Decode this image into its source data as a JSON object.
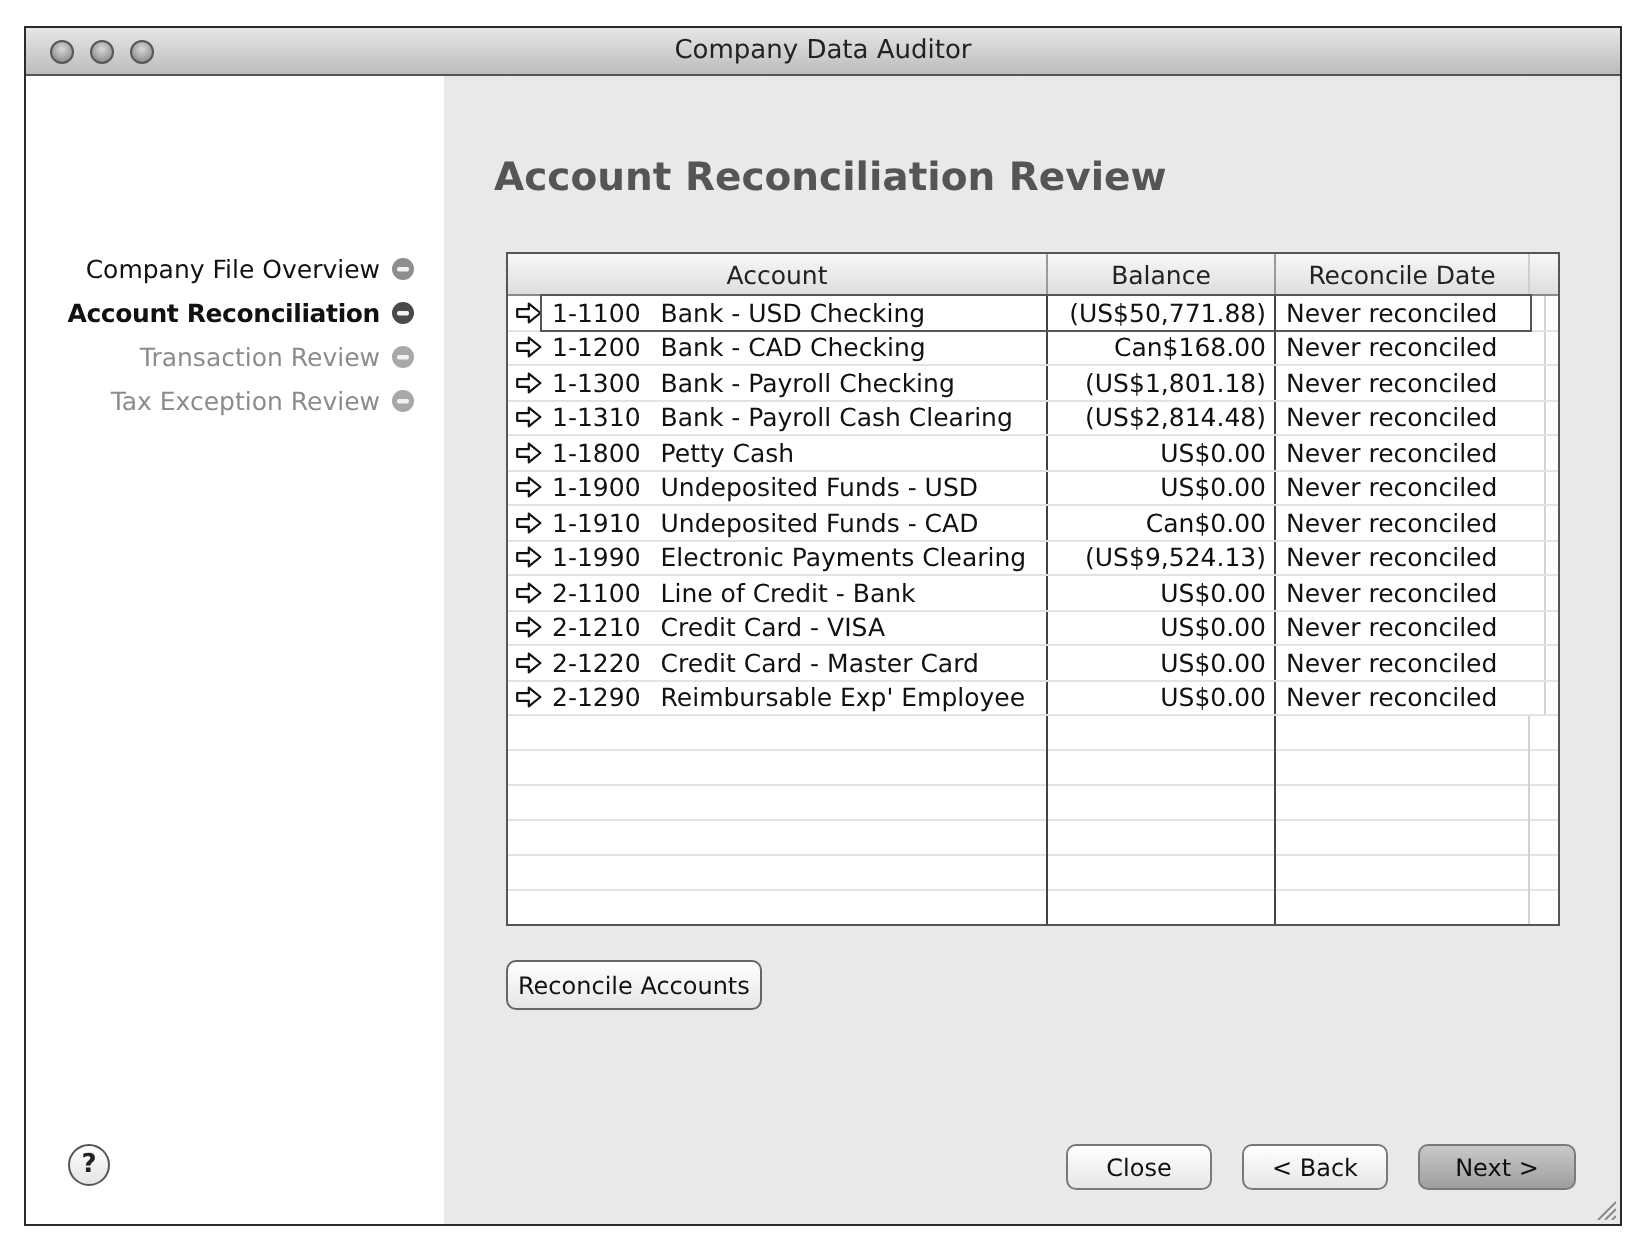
{
  "window": {
    "title": "Company Data Auditor"
  },
  "steps": [
    {
      "label": "Company File Overview",
      "selected": false,
      "disabled": false
    },
    {
      "label": "Account Reconciliation",
      "selected": true,
      "disabled": false
    },
    {
      "label": "Transaction Review",
      "selected": false,
      "disabled": true
    },
    {
      "label": "Tax Exception Review",
      "selected": false,
      "disabled": true
    }
  ],
  "help_button": "?",
  "heading": "Account Reconciliation Review",
  "table": {
    "columns": [
      "Account",
      "Balance",
      "Reconcile Date"
    ],
    "rows": [
      {
        "code": "1-1100",
        "account": "Bank - USD Checking",
        "balance": "(US$50,771.88)",
        "reconcile_date": "Never reconciled",
        "selected": true
      },
      {
        "code": "1-1200",
        "account": "Bank - CAD Checking",
        "balance": "Can$168.00",
        "reconcile_date": "Never reconciled",
        "selected": false
      },
      {
        "code": "1-1300",
        "account": "Bank - Payroll Checking",
        "balance": "(US$1,801.18)",
        "reconcile_date": "Never reconciled",
        "selected": false
      },
      {
        "code": "1-1310",
        "account": "Bank - Payroll Cash Clearing",
        "balance": "(US$2,814.48)",
        "reconcile_date": "Never reconciled",
        "selected": false
      },
      {
        "code": "1-1800",
        "account": "Petty Cash",
        "balance": "US$0.00",
        "reconcile_date": "Never reconciled",
        "selected": false
      },
      {
        "code": "1-1900",
        "account": "Undeposited Funds - USD",
        "balance": "US$0.00",
        "reconcile_date": "Never reconciled",
        "selected": false
      },
      {
        "code": "1-1910",
        "account": "Undeposited Funds - CAD",
        "balance": "Can$0.00",
        "reconcile_date": "Never reconciled",
        "selected": false
      },
      {
        "code": "1-1990",
        "account": "Electronic Payments Clearing",
        "balance": "(US$9,524.13)",
        "reconcile_date": "Never reconciled",
        "selected": false
      },
      {
        "code": "2-1100",
        "account": "Line of Credit - Bank",
        "balance": "US$0.00",
        "reconcile_date": "Never reconciled",
        "selected": false
      },
      {
        "code": "2-1210",
        "account": "Credit Card - VISA",
        "balance": "US$0.00",
        "reconcile_date": "Never reconciled",
        "selected": false
      },
      {
        "code": "2-1220",
        "account": "Credit Card - Master Card",
        "balance": "US$0.00",
        "reconcile_date": "Never reconciled",
        "selected": false
      },
      {
        "code": "2-1290",
        "account": "Reimbursable Exp' Employee",
        "balance": "US$0.00",
        "reconcile_date": "Never reconciled",
        "selected": false
      }
    ]
  },
  "reconcile_button": "Reconcile Accounts",
  "buttons": [
    {
      "label": "Close",
      "default": false
    },
    {
      "label": "< Back",
      "default": false
    },
    {
      "label": "Next >",
      "default": true
    }
  ]
}
